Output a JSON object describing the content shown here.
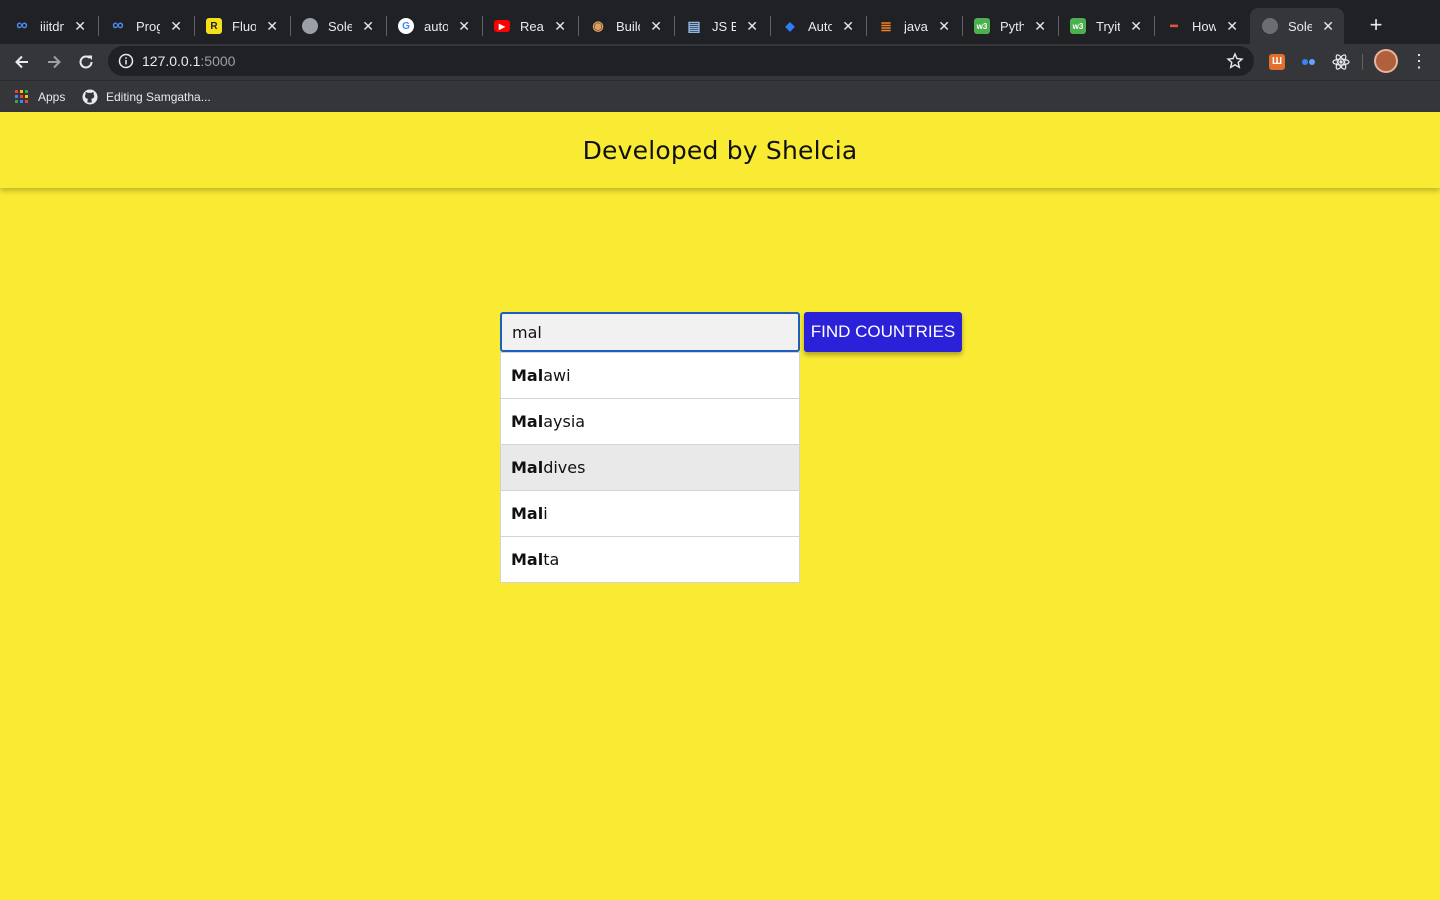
{
  "browser": {
    "tabs": [
      {
        "title": "iiitdm",
        "icon": "infinity-icon",
        "color": "#4c8bf5"
      },
      {
        "title": "Progr",
        "icon": "infinity-icon",
        "color": "#4c8bf5"
      },
      {
        "title": "Fluox",
        "icon": "r-badge-icon",
        "color": "#f7e018"
      },
      {
        "title": "Solen",
        "icon": "globe-icon",
        "color": "#9aa0a6"
      },
      {
        "title": "autoc",
        "icon": "google-icon",
        "color": "#ffffff"
      },
      {
        "title": "React",
        "icon": "youtube-icon",
        "color": "#ff0000"
      },
      {
        "title": "Build",
        "icon": "owl-icon",
        "color": "#e0a060"
      },
      {
        "title": "JS Bir",
        "icon": "jsbin-icon",
        "color": "#8fb7e6"
      },
      {
        "title": "Autoc",
        "icon": "mui-icon",
        "color": "#2f7cf6"
      },
      {
        "title": "javasc",
        "icon": "stackoverflow-icon",
        "color": "#f48024"
      },
      {
        "title": "Pytho",
        "icon": "w3-icon",
        "color": "#4caf50"
      },
      {
        "title": "Tryit E",
        "icon": "w3-icon",
        "color": "#4caf50"
      },
      {
        "title": "How t",
        "icon": "dash-icon",
        "color": "#e8533f"
      },
      {
        "title": "Solen",
        "icon": "globe-icon",
        "color": "#6b6d70",
        "active": true
      }
    ],
    "url_host": "127.0.0.1",
    "url_port": ":5000",
    "bookmarks": [
      {
        "label": "Apps",
        "icon": "apps-grid-icon"
      },
      {
        "label": "Editing Samgatha...",
        "icon": "github-icon"
      }
    ]
  },
  "page": {
    "header_title": "Developed by Shelcia",
    "background_color": "#f9ea33",
    "search": {
      "value": "mal",
      "button_label": "FIND COUNTRIES",
      "button_color": "#2a21d8"
    },
    "suggestions": [
      {
        "match": "Mal",
        "rest": "awi",
        "highlighted": false
      },
      {
        "match": "Mal",
        "rest": "aysia",
        "highlighted": false
      },
      {
        "match": "Mal",
        "rest": "dives",
        "highlighted": true
      },
      {
        "match": "Mal",
        "rest": "i",
        "highlighted": false
      },
      {
        "match": "Mal",
        "rest": "ta",
        "highlighted": false
      }
    ]
  }
}
